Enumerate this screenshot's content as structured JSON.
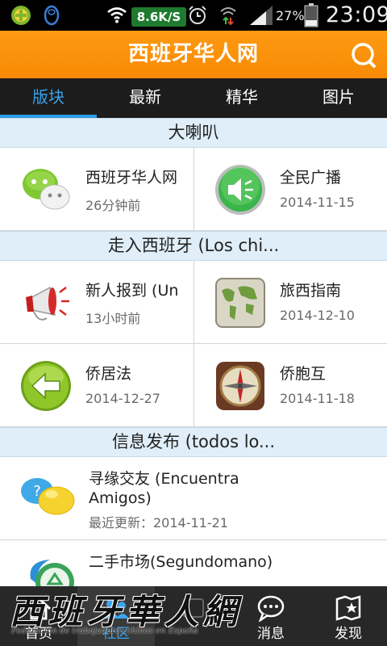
{
  "status_bar": {
    "net_speed": "8.6K/S",
    "battery_pct": "27%",
    "time": "23:09",
    "icons": [
      "app-notification-icon",
      "qq-penguin-icon",
      "wifi-icon",
      "alarm-clock-icon",
      "data-transfer-icon",
      "signal-icon",
      "battery-icon"
    ]
  },
  "header": {
    "title": "西班牙华人网",
    "search_icon": "search-icon",
    "bg_color": "#f78a04"
  },
  "tabs": [
    {
      "label": "版块",
      "active": true
    },
    {
      "label": "最新",
      "active": false
    },
    {
      "label": "精华",
      "active": false
    },
    {
      "label": "图片",
      "active": false
    }
  ],
  "sections": [
    {
      "title": "大喇叭",
      "rows": [
        [
          {
            "name": "西班牙华人网",
            "date": "26分钟前",
            "icon": "wechat-bubbles-icon"
          },
          {
            "name": "全民广播",
            "date": "2014-11-15",
            "icon": "speaker-icon"
          }
        ]
      ]
    },
    {
      "title": "走入西班牙 (Los chi...",
      "rows": [
        [
          {
            "name": "新人报到 (Un",
            "date": "13小时前",
            "icon": "megaphone-icon"
          },
          {
            "name": "旅西指南",
            "date": "2014-12-10",
            "icon": "world-map-icon"
          }
        ],
        [
          {
            "name": "侨居法",
            "date": "2014-12-27",
            "icon": "green-back-arrow-icon"
          },
          {
            "name": "侨胞互",
            "date": "2014-11-18",
            "icon": "compass-icon"
          }
        ]
      ]
    },
    {
      "title": "信息发布 (todos lo...",
      "items": [
        {
          "name": "寻缘交友 (Encuentra Amigos)",
          "date": "最近更新：2014-11-21",
          "icon": "hello-chat-bubbles-icon"
        },
        {
          "name": "二手市场(Segundomano)",
          "date": "",
          "icon": "recycle-icon"
        }
      ]
    }
  ],
  "bottom_nav": [
    {
      "label": "首页",
      "icon": "home-icon",
      "active": false
    },
    {
      "label": "社区",
      "icon": "community-icon",
      "active": true
    },
    {
      "label": "",
      "icon": "blank-icon",
      "active": false
    },
    {
      "label": "消息",
      "icon": "chat-bubble-icon",
      "active": false
    },
    {
      "label": "发现",
      "icon": "map-flag-icon",
      "active": false
    }
  ],
  "watermark": {
    "title": "西班牙華人網",
    "subtitle": "Federación de trabajadores chinos en España"
  }
}
